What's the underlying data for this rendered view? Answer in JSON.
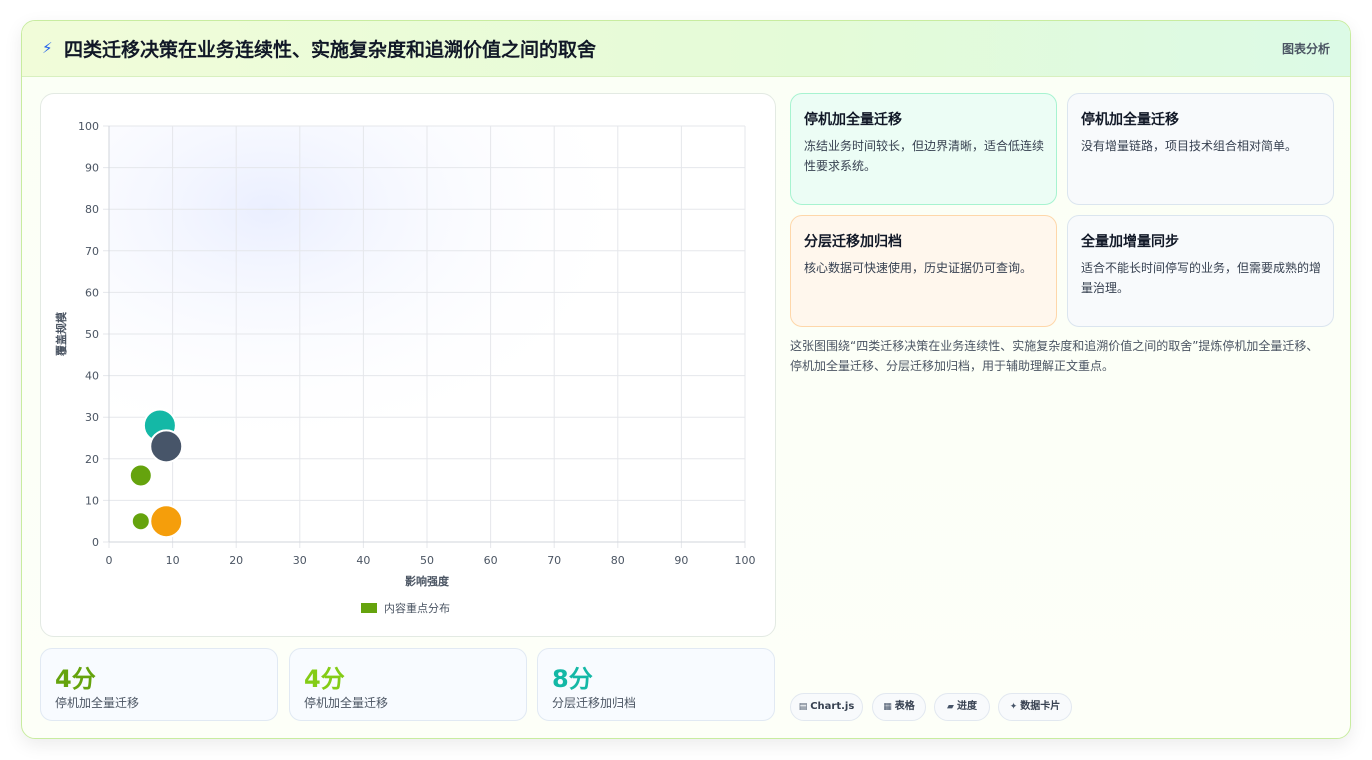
{
  "header": {
    "title": "四类迁移决策在业务连续性、实施复杂度和追溯价值之间的取舍",
    "tag": "图表分析"
  },
  "chart_data": {
    "type": "scatter",
    "xlabel": "影响强度",
    "ylabel": "覆盖规模",
    "xlim": [
      0,
      100
    ],
    "ylim": [
      0,
      100
    ],
    "xticks": [
      0,
      10,
      20,
      30,
      40,
      50,
      60,
      70,
      80,
      90,
      100
    ],
    "yticks": [
      0,
      10,
      20,
      30,
      40,
      50,
      60,
      70,
      80,
      90,
      100
    ],
    "grid": true,
    "legend_position": "bottom",
    "legend": "内容重点分布",
    "legend_color": "#65a30d",
    "points": [
      {
        "x": 8,
        "y": 28,
        "size": "large",
        "color": "#14b8a6"
      },
      {
        "x": 9,
        "y": 23,
        "size": "large",
        "color": "#475569"
      },
      {
        "x": 5,
        "y": 16,
        "size": "medium",
        "color": "#65a30d"
      },
      {
        "x": 5,
        "y": 5,
        "size": "small",
        "color": "#65a30d"
      },
      {
        "x": 9,
        "y": 5,
        "size": "large",
        "color": "#f59e0b"
      }
    ]
  },
  "stats": [
    {
      "value": "4分",
      "label": "停机加全量迁移",
      "color": "#65a30d"
    },
    {
      "value": "4分",
      "label": "停机加全量迁移",
      "color": "#84cc16"
    },
    {
      "value": "8分",
      "label": "分层迁移加归档",
      "color": "#14b8a6"
    }
  ],
  "cards": [
    {
      "title": "停机加全量迁移",
      "body": "冻结业务时间较长，但边界清晰，适合低连续性要求系统。",
      "bg": "#ecfdf5",
      "border": "#a7f3d0"
    },
    {
      "title": "停机加全量迁移",
      "body": "没有增量链路，项目技术组合相对简单。",
      "bg": "#f8fafc",
      "border": "#dbe5ef"
    },
    {
      "title": "分层迁移加归档",
      "body": "核心数据可快速使用，历史证据仍可查询。",
      "bg": "#fff7ed",
      "border": "#fed7aa"
    },
    {
      "title": "全量加增量同步",
      "body": "适合不能长时间停写的业务，但需要成熟的增量治理。",
      "bg": "#f8fafc",
      "border": "#dbe5ef"
    }
  ],
  "summary": "这张图围绕“四类迁移决策在业务连续性、实施复杂度和追溯价值之间的取舍”提炼停机加全量迁移、停机加全量迁移、分层迁移加归档，用于辅助理解正文重点。",
  "chips": [
    {
      "icon": "▤",
      "label": "Chart.js"
    },
    {
      "icon": "▦",
      "label": "表格"
    },
    {
      "icon": "▰",
      "label": "进度"
    },
    {
      "icon": "✦",
      "label": "数据卡片"
    }
  ]
}
